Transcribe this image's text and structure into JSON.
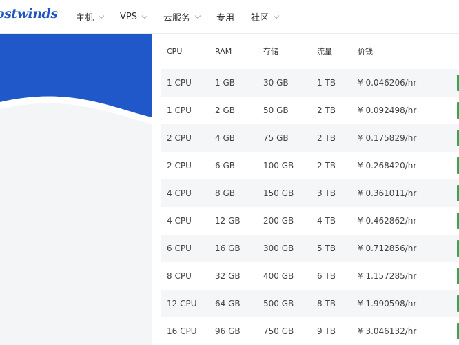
{
  "header": {
    "logo": "ostwinds",
    "nav": [
      {
        "label": "主机",
        "dropdown": true
      },
      {
        "label": "VPS",
        "dropdown": true
      },
      {
        "label": "云服务",
        "dropdown": true
      },
      {
        "label": "专用",
        "dropdown": false
      },
      {
        "label": "社区",
        "dropdown": true
      }
    ]
  },
  "colors": {
    "brand": "#1f56c4",
    "buy": "#2fa84f"
  },
  "table": {
    "headers": {
      "cpu": "CPU",
      "ram": "RAM",
      "storage": "存储",
      "traffic": "流量",
      "price": "价钱"
    },
    "rows": [
      {
        "cpu": "1 CPU",
        "ram": "1 GB",
        "storage": "30 GB",
        "traffic": "1 TB",
        "price": "¥ 0.046206/hr"
      },
      {
        "cpu": "1 CPU",
        "ram": "2 GB",
        "storage": "50 GB",
        "traffic": "2 TB",
        "price": "¥ 0.092498/hr"
      },
      {
        "cpu": "2 CPU",
        "ram": "4 GB",
        "storage": "75 GB",
        "traffic": "2 TB",
        "price": "¥ 0.175829/hr"
      },
      {
        "cpu": "2 CPU",
        "ram": "6 GB",
        "storage": "100 GB",
        "traffic": "2 TB",
        "price": "¥ 0.268420/hr"
      },
      {
        "cpu": "4 CPU",
        "ram": "8 GB",
        "storage": "150 GB",
        "traffic": "3 TB",
        "price": "¥ 0.361011/hr"
      },
      {
        "cpu": "4 CPU",
        "ram": "12 GB",
        "storage": "200 GB",
        "traffic": "4 TB",
        "price": "¥ 0.462862/hr"
      },
      {
        "cpu": "6 CPU",
        "ram": "16 GB",
        "storage": "300 GB",
        "traffic": "5 TB",
        "price": "¥ 0.712856/hr"
      },
      {
        "cpu": "8 CPU",
        "ram": "32 GB",
        "storage": "400 GB",
        "traffic": "6 TB",
        "price": "¥ 1.157285/hr"
      },
      {
        "cpu": "12 CPU",
        "ram": "64 GB",
        "storage": "500 GB",
        "traffic": "8 TB",
        "price": "¥ 1.990598/hr"
      },
      {
        "cpu": "16 CPU",
        "ram": "96 GB",
        "storage": "750 GB",
        "traffic": "9 TB",
        "price": "¥ 3.046132/hr"
      }
    ]
  }
}
